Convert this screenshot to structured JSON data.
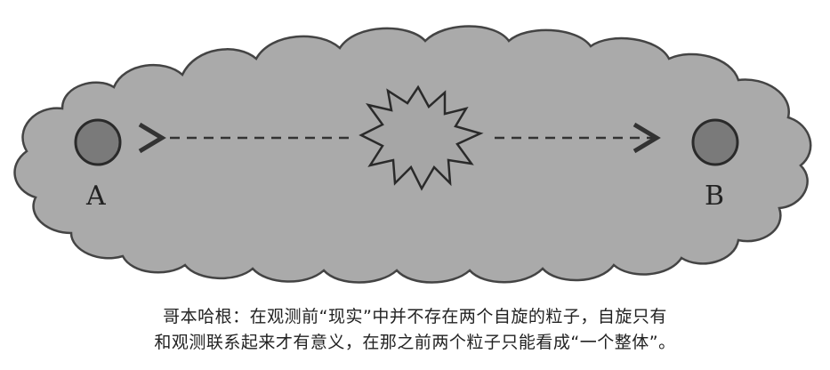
{
  "colors": {
    "cloud_fill": "#aaaaaa",
    "cloud_stroke": "#444444",
    "particle_fill": "#7a7a7a",
    "particle_stroke": "#2a2a2a",
    "burst_fill": "#a6a6a6",
    "arrow": "#333333",
    "text": "#222222"
  },
  "diagram": {
    "particle_a_label": "A",
    "particle_b_label": "B",
    "center": "burst-icon",
    "arrows": [
      "arrow-left",
      "arrow-right"
    ]
  },
  "caption": {
    "line1": "哥本哈根：在观测前“现实”中并不存在两个自旋的粒子，自旋只有",
    "line2": "和观测联系起来才有意义，在那之前两个粒子只能看成“一个整体”。"
  }
}
